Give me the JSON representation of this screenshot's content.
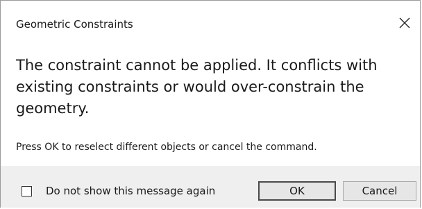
{
  "dialog": {
    "title": "Geometric Constraints",
    "close_icon": "close-icon",
    "message": "The constraint cannot be applied. It conflicts with existing constraints or would over-constrain the geometry.",
    "instruction": "Press OK to reselect different objects or cancel the command.",
    "checkbox": {
      "label": "Do not show this message again",
      "checked": false
    },
    "buttons": {
      "ok_label": "OK",
      "cancel_label": "Cancel"
    }
  }
}
